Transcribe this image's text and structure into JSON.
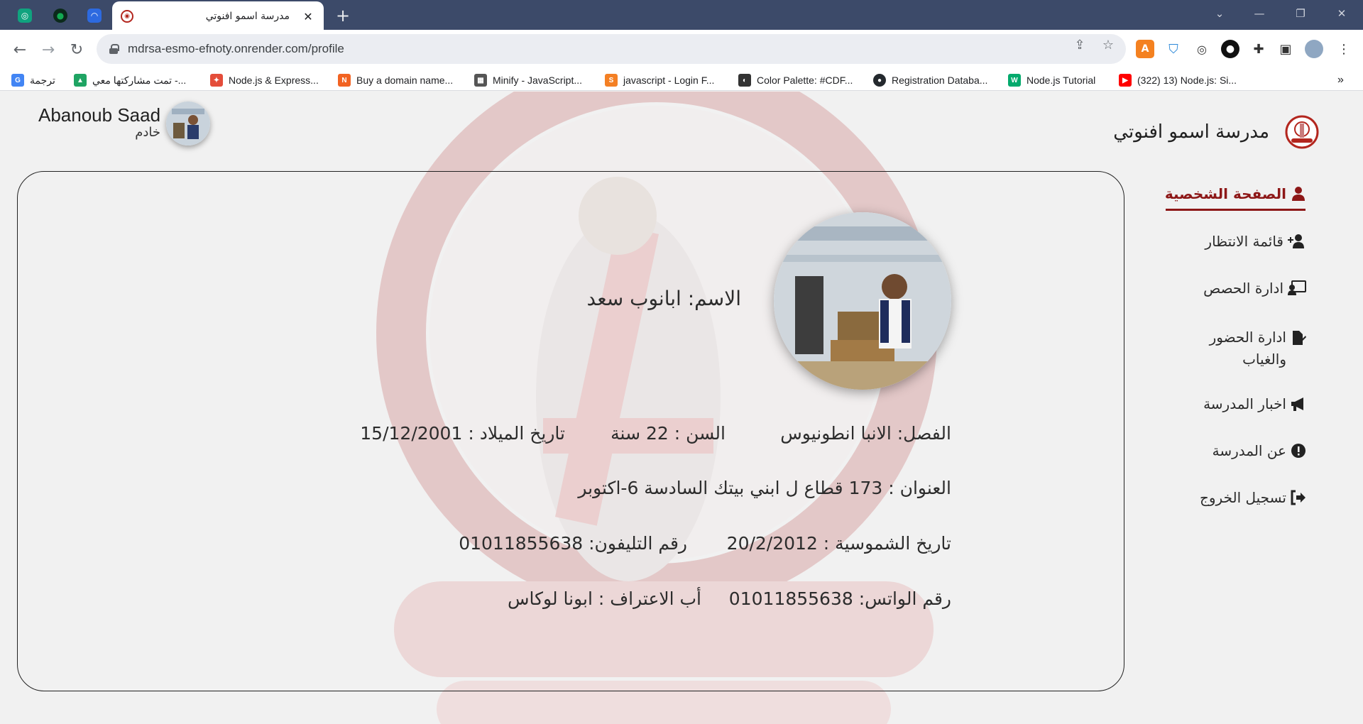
{
  "browser": {
    "tab_title": "مدرسة اسمو افنوتي",
    "tab_close": "✕",
    "new_tab": "+",
    "url": "mdrsa-esmo-efnoty.onrender.com/profile",
    "bookmarks": [
      {
        "label": "ترجمة",
        "icon": "google-translate-icon",
        "color": "#4285f4"
      },
      {
        "label": "تمت مشاركتها معي -...",
        "icon": "google-drive-icon",
        "color": "#1fa463"
      },
      {
        "label": "Node.js & Express...",
        "icon": "puzzle-bookmark-icon",
        "color": "#e44d3a"
      },
      {
        "label": "Buy a domain name...",
        "icon": "namecheap-icon",
        "color": "#f26322"
      },
      {
        "label": "Minify - JavaScript...",
        "icon": "minify-icon",
        "color": "#555555"
      },
      {
        "label": "javascript - Login F...",
        "icon": "stackoverflow-icon",
        "color": "#f48024"
      },
      {
        "label": "Color Palette: #CDF...",
        "icon": "color-palette-icon",
        "color": "#333333"
      },
      {
        "label": "Registration Databa...",
        "icon": "github-icon",
        "color": "#24292e"
      },
      {
        "label": "Node.js Tutorial",
        "icon": "w3schools-icon",
        "color": "#04aa6d"
      },
      {
        "label": "(322) 13) Node.js: Si...",
        "icon": "youtube-icon",
        "color": "#ff0000"
      }
    ],
    "bookmarks_more": "»"
  },
  "header": {
    "user_name": "Abanoub Saad",
    "user_role": "خادم",
    "brand_name": "مدرسة اسمو افنوتي"
  },
  "sidebar": {
    "items": [
      {
        "label": "الصفحة الشخصية",
        "icon": "user-icon",
        "active": true
      },
      {
        "label": "قائمة الانتظار",
        "icon": "user-plus-icon",
        "active": false
      },
      {
        "label": "ادارة الحصص",
        "icon": "chalkboard-teacher-icon",
        "active": false
      },
      {
        "label": "ادارة الحضور والغياب",
        "icon": "file-signature-icon",
        "active": false
      },
      {
        "label": "اخبار المدرسة",
        "icon": "bullhorn-icon",
        "active": false
      },
      {
        "label": "عن المدرسة",
        "icon": "exclamation-circle-icon",
        "active": false
      },
      {
        "label": "تسجيل الخروج",
        "icon": "sign-out-icon",
        "active": false
      }
    ]
  },
  "profile": {
    "name": "الاسم: ابانوب سعد",
    "class": "الفصل: الانبا انطونيوس",
    "age": "السن : 22 سنة",
    "birth_date": "تاريخ الميلاد : 15/12/2001",
    "address": "العنوان : 173 قطاع ل ابني بيتك السادسة 6-اكتوبر",
    "deacon_date": "تاريخ الشموسية : 20/2/2012",
    "phone": "رقم التليفون: 01011855638",
    "whatsapp": "رقم الواتس: 01011855638",
    "confession_father": "أب الاعتراف : ابونا لوكاس"
  },
  "colors": {
    "accent": "#8d1717",
    "tab_bar": "#3c4a69",
    "page_bg": "#f1f1f1"
  }
}
